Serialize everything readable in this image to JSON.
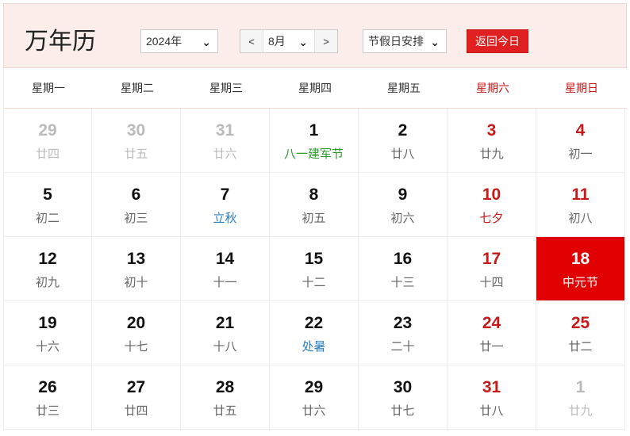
{
  "header": {
    "title": "万年历",
    "year_select": "2024年",
    "month_prev": "<",
    "month_select": "8月",
    "month_next": ">",
    "holiday_select": "节假日安排",
    "today_button": "返回今日"
  },
  "weekdays": [
    "星期一",
    "星期二",
    "星期三",
    "星期四",
    "星期五",
    "星期六",
    "星期日"
  ],
  "weeks": [
    [
      {
        "d": "29",
        "s": "廿四"
      },
      {
        "d": "30",
        "s": "廿五"
      },
      {
        "d": "31",
        "s": "廿六"
      },
      {
        "d": "1",
        "s": "八一建军节"
      },
      {
        "d": "2",
        "s": "廿八"
      },
      {
        "d": "3",
        "s": "廿九"
      },
      {
        "d": "4",
        "s": "初一"
      }
    ],
    [
      {
        "d": "5",
        "s": "初二"
      },
      {
        "d": "6",
        "s": "初三"
      },
      {
        "d": "7",
        "s": "立秋"
      },
      {
        "d": "8",
        "s": "初五"
      },
      {
        "d": "9",
        "s": "初六"
      },
      {
        "d": "10",
        "s": "七夕"
      },
      {
        "d": "11",
        "s": "初八"
      }
    ],
    [
      {
        "d": "12",
        "s": "初九"
      },
      {
        "d": "13",
        "s": "初十"
      },
      {
        "d": "14",
        "s": "十一"
      },
      {
        "d": "15",
        "s": "十二"
      },
      {
        "d": "16",
        "s": "十三"
      },
      {
        "d": "17",
        "s": "十四"
      },
      {
        "d": "18",
        "s": "中元节"
      }
    ],
    [
      {
        "d": "19",
        "s": "十六"
      },
      {
        "d": "20",
        "s": "十七"
      },
      {
        "d": "21",
        "s": "十八"
      },
      {
        "d": "22",
        "s": "处暑"
      },
      {
        "d": "23",
        "s": "二十"
      },
      {
        "d": "24",
        "s": "廿一"
      },
      {
        "d": "25",
        "s": "廿二"
      }
    ],
    [
      {
        "d": "26",
        "s": "廿三"
      },
      {
        "d": "27",
        "s": "廿四"
      },
      {
        "d": "28",
        "s": "廿五"
      },
      {
        "d": "29",
        "s": "廿六"
      },
      {
        "d": "30",
        "s": "廿七"
      },
      {
        "d": "31",
        "s": "廿八"
      },
      {
        "d": "1",
        "s": "廿九"
      }
    ]
  ]
}
